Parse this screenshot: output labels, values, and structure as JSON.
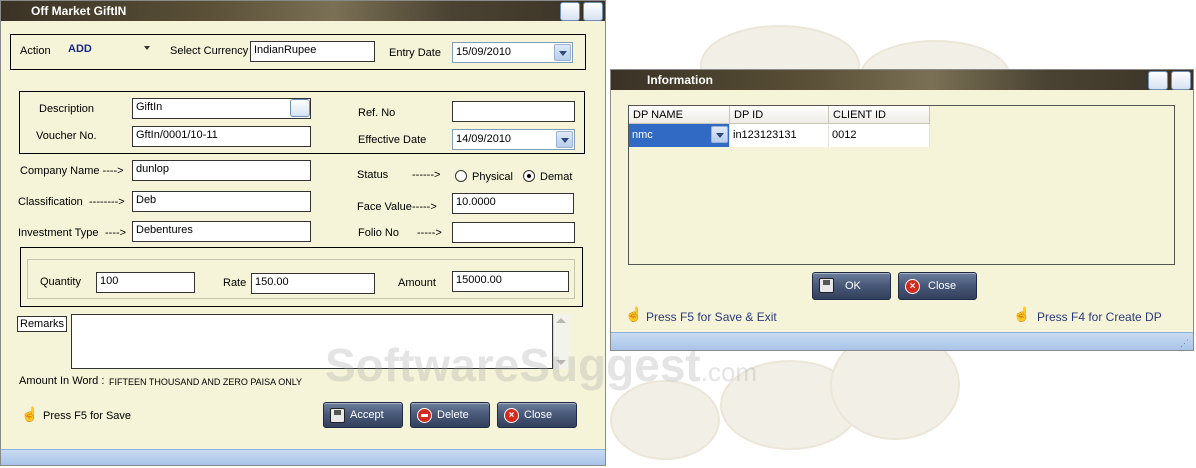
{
  "watermark": {
    "main": "SoftwareSuggest",
    "suffix": ".com"
  },
  "gift_window": {
    "title": "Off Market GiftIN",
    "action_label": "Action",
    "action_value": "ADD",
    "currency_label": "Select Currency",
    "currency_value": "IndianRupee",
    "entry_date_label": "Entry Date",
    "entry_date_value": "15/09/2010",
    "description_label": "Description",
    "description_value": "GiftIn",
    "voucher_label": "Voucher No.",
    "voucher_value": "GftIn/0001/10-11",
    "refno_label": "Ref. No",
    "refno_value": "",
    "effective_date_label": "Effective Date",
    "effective_date_value": "14/09/2010",
    "company_label": "Company Name ---->",
    "company_value": "dunlop",
    "status_label": "Status",
    "status_arrow": "------>",
    "status_options": [
      "Physical",
      "Demat"
    ],
    "status_selected": "Demat",
    "classification_label": "Classification",
    "classification_arrow": "-------->",
    "classification_value": "Deb",
    "face_value_label": "Face Value",
    "face_value_arrow": "----->",
    "face_value": "10.0000",
    "investment_label": "Investment Type",
    "investment_arrow": "---->",
    "investment_value": "Debentures",
    "folio_label": "Folio No",
    "folio_arrow": "----->",
    "folio_value": "",
    "quantity_label": "Quantity",
    "quantity_value": "100",
    "rate_label": "Rate",
    "rate_value": "150.00",
    "amount_label": "Amount",
    "amount_value": "15000.00",
    "remarks_label": "Remarks",
    "remarks_value": "",
    "amount_words_label": "Amount In Word :",
    "amount_words_value": "FIFTEEN THOUSAND AND ZERO PAISA ONLY",
    "hint": "Press F5 for Save",
    "accept_label": "Accept",
    "delete_label": "Delete",
    "close_label": "Close"
  },
  "info_window": {
    "title": "Information",
    "columns": [
      "DP NAME",
      "DP ID",
      "CLIENT ID"
    ],
    "row": {
      "dp_name": "nmc",
      "dp_id": "in123123131",
      "client_id": "0012"
    },
    "ok_label": "OK",
    "close_label": "Close",
    "hint_save": "Press F5 for Save & Exit",
    "hint_create": "Press F4 for Create DP"
  }
}
